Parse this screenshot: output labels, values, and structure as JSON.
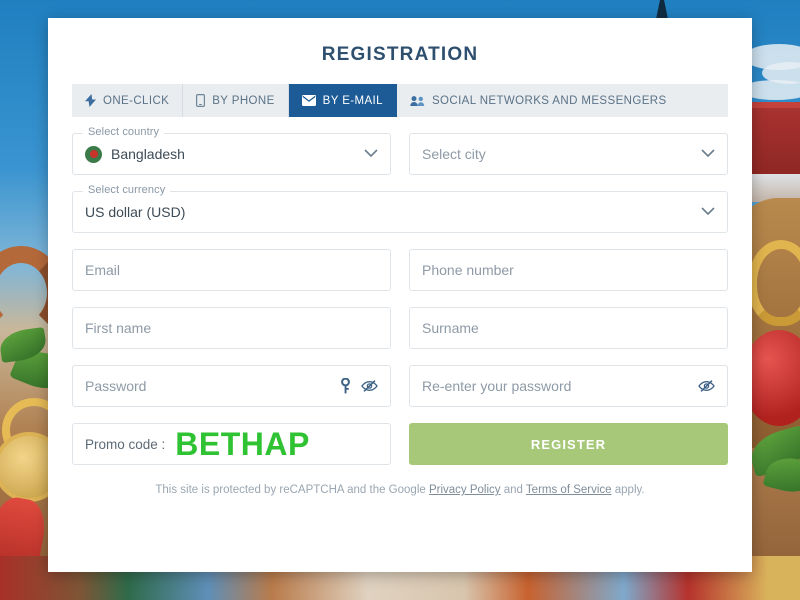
{
  "card": {
    "title": "REGISTRATION"
  },
  "tabs": [
    {
      "label": "ONE-CLICK",
      "icon": "bolt-icon",
      "active": false
    },
    {
      "label": "BY PHONE",
      "icon": "phone-icon",
      "active": false
    },
    {
      "label": "BY E-MAIL",
      "icon": "envelope-icon",
      "active": true
    },
    {
      "label": "SOCIAL NETWORKS AND MESSENGERS",
      "icon": "people-icon",
      "active": false
    }
  ],
  "form": {
    "country": {
      "legend": "Select country",
      "value": "Bangladesh",
      "flag_bg": "#3c7a4a",
      "flag_dot": "#c8332b"
    },
    "city": {
      "placeholder": "Select city"
    },
    "currency": {
      "legend": "Select currency",
      "value": "US dollar (USD)"
    },
    "email": {
      "placeholder": "Email",
      "value": ""
    },
    "phone": {
      "placeholder": "Phone number",
      "value": ""
    },
    "first_name": {
      "placeholder": "First name",
      "value": ""
    },
    "surname": {
      "placeholder": "Surname",
      "value": ""
    },
    "password": {
      "placeholder": "Password",
      "value": ""
    },
    "password_confirm": {
      "placeholder": "Re-enter your password",
      "value": ""
    },
    "promo": {
      "label": "Promo code :",
      "code": "BETHAP",
      "code_color": "#2fc232"
    },
    "register": {
      "label": "REGISTER",
      "color": "#a6c878"
    }
  },
  "legal": {
    "prefix": "This site is protected by reCAPTCHA and the Google ",
    "privacy": "Privacy Policy",
    "middle": " and ",
    "terms": "Terms of Service",
    "suffix": " apply."
  },
  "theme": {
    "accent": "#1d5b96",
    "title_color": "#2f4f6f",
    "tabbar_bg": "#e9edf0"
  }
}
